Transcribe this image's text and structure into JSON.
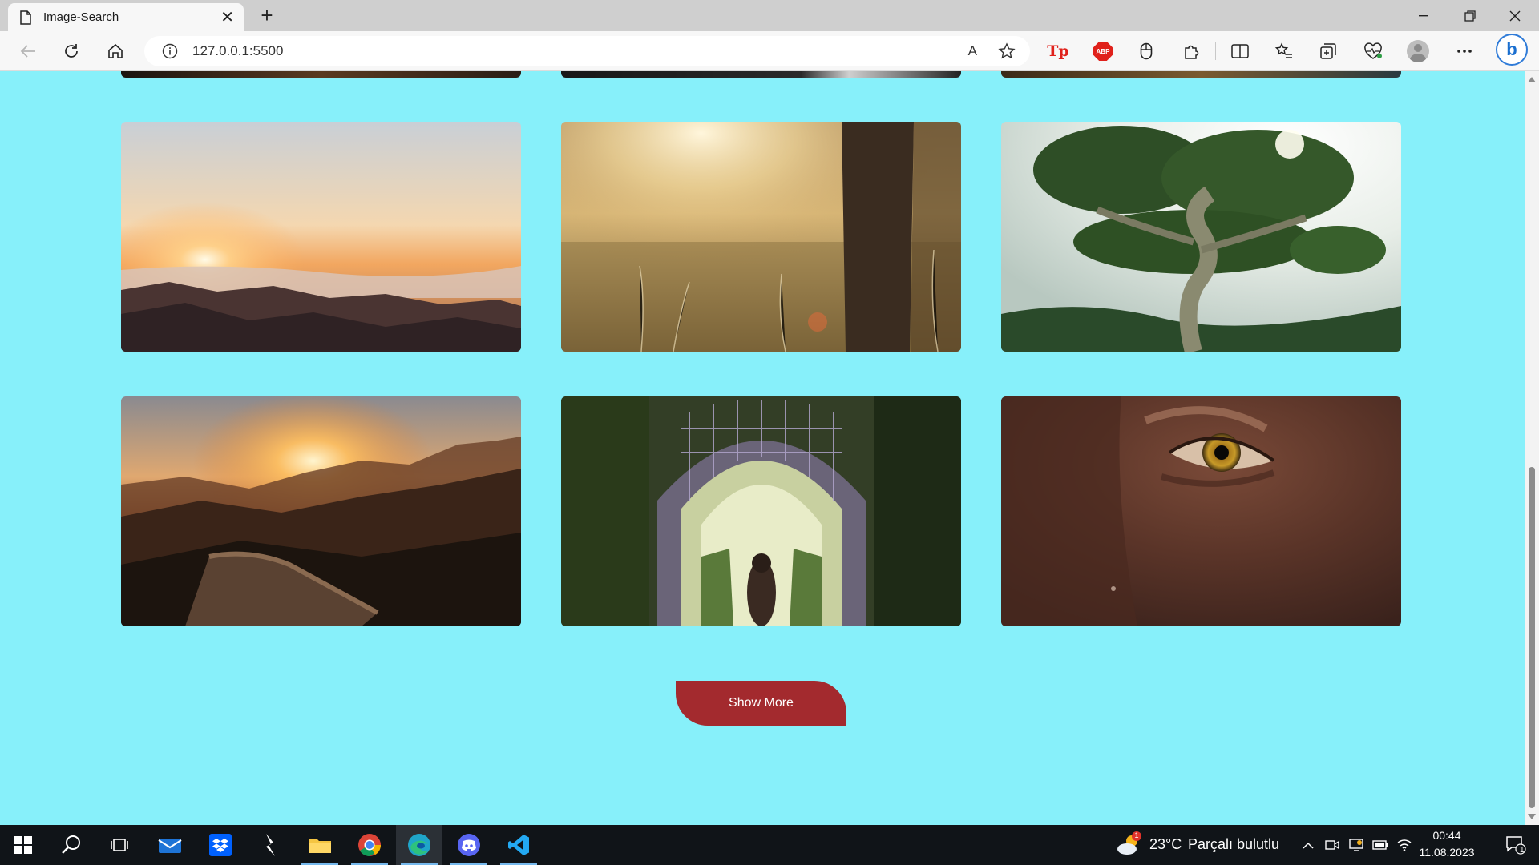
{
  "browser": {
    "tab_title": "Image-Search",
    "new_tab_symbol": "+",
    "close_symbol": "✕",
    "url": "127.0.0.1:5500",
    "read_aloud_label": "A"
  },
  "page": {
    "show_more_label": "Show More",
    "background_color": "#87f0fa",
    "button_color": "#a32a2e",
    "images": [
      {
        "name": "sunset-above-clouds",
        "icon": "landscape-photo"
      },
      {
        "name": "sunlit-meadow-tree-trunk",
        "icon": "landscape-photo"
      },
      {
        "name": "twisted-tree-backlit",
        "icon": "landscape-photo"
      },
      {
        "name": "great-wall-sunset",
        "icon": "landscape-photo"
      },
      {
        "name": "garden-archway-woman",
        "icon": "landscape-photo"
      },
      {
        "name": "close-up-eye",
        "icon": "portrait-photo"
      }
    ]
  },
  "taskbar": {
    "weather_temp": "23°C",
    "weather_desc": "Parçalı bulutlu",
    "weather_badge": "1",
    "time": "00:44",
    "date": "11.08.2023",
    "notification_count": "1"
  }
}
